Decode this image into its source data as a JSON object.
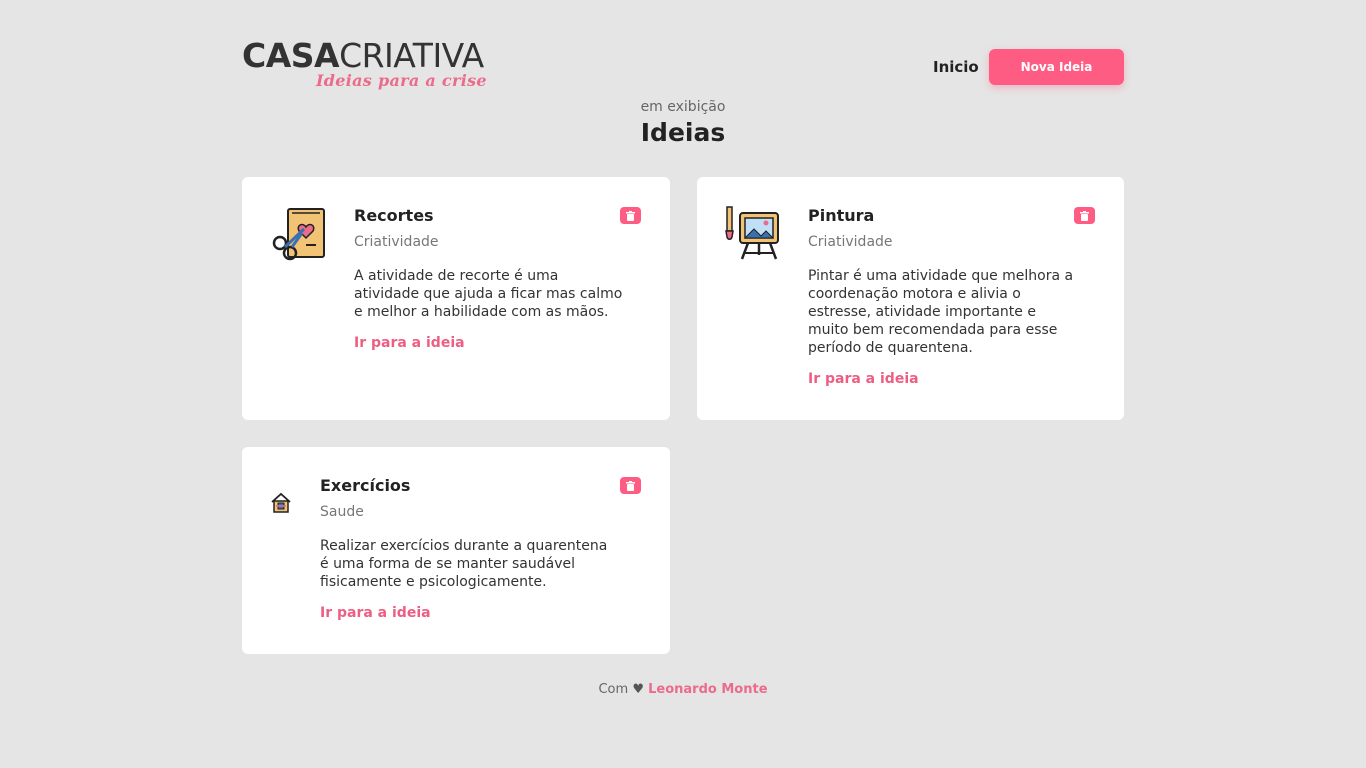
{
  "header": {
    "logo_bold": "CASA",
    "logo_light": "CRIATIVA",
    "logo_tagline": "Ideias para a crise",
    "nav_home": "Inicio",
    "new_idea_button": "Nova Ideia"
  },
  "main": {
    "subtitle": "em exibição",
    "title": "Ideias"
  },
  "cards": [
    {
      "icon": "scissors-card-icon",
      "title": "Recortes",
      "category": "Criatividade",
      "description": "A atividade de recorte é uma atividade que ajuda a ficar mas calmo e melhor a habilidade com as mãos.",
      "link": "Ir para a ideia"
    },
    {
      "icon": "easel-painting-icon",
      "title": "Pintura",
      "category": "Criatividade",
      "description": "Pintar é uma atividade que melhora a coordenação motora e alivia o estresse, atividade importante e muito bem recomendada para esse período de quarentena.",
      "link": "Ir para a ideia"
    },
    {
      "icon": "home-exercise-icon",
      "title": "Exercícios",
      "category": "Saude",
      "description": "Realizar exercícios durante a quarentena é uma forma de se manter saudável fisicamente e psicologicamente.",
      "link": "Ir para a ideia"
    }
  ],
  "footer": {
    "prefix": "Com",
    "heart": "♥",
    "author": "Leonardo Monte"
  },
  "colors": {
    "accent": "#ff5c84",
    "background": "#e5e5e5",
    "card": "#ffffff"
  }
}
